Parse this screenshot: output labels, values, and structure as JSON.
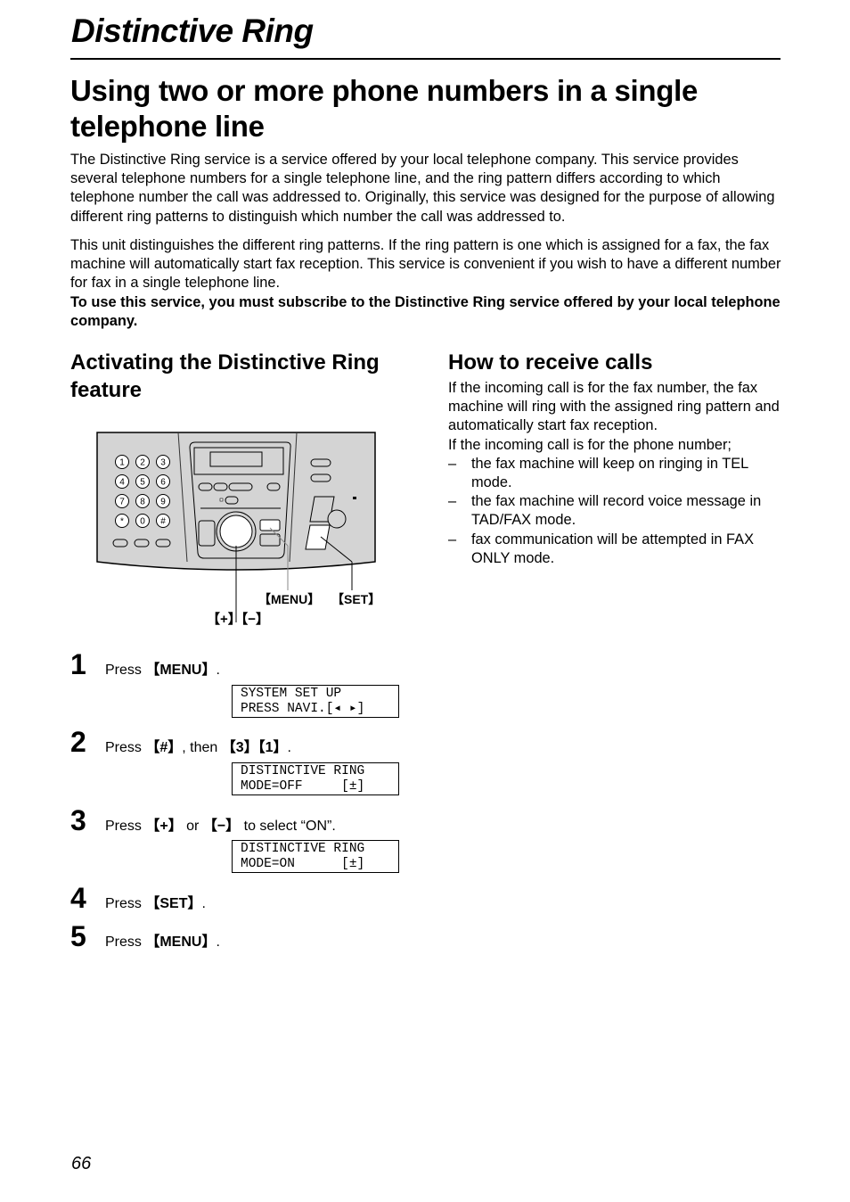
{
  "header": {
    "page_title": "Distinctive Ring"
  },
  "main": {
    "heading": "Using two or more phone numbers in a single telephone line",
    "paragraphs": [
      "The Distinctive Ring service is a service offered by your local telephone company. This service provides several telephone numbers for a single telephone line, and the ring pattern differs according to which telephone number the call was addressed to. Originally, this service was designed for the purpose of allowing different ring patterns to distinguish which number the call was addressed to.",
      "This unit distinguishes the different ring patterns. If the ring pattern is one which is assigned for a fax, the fax machine will automatically start fax reception. This service is convenient if you wish to have a different number for fax in a single telephone line."
    ],
    "notice": "To use this service, you must subscribe to the Distinctive Ring service offered by your local telephone company."
  },
  "activating": {
    "heading_line1": "Activating the Distinctive Ring",
    "heading_line2": "feature",
    "diagram": {
      "keypad": [
        "1",
        "2",
        "3",
        "4",
        "5",
        "6",
        "7",
        "8",
        "9",
        "*",
        "0",
        "#"
      ],
      "label_menu": "【MENU】",
      "label_set": "【SET】",
      "label_plus_minus": "【+】【−】"
    },
    "steps": [
      {
        "num": "1",
        "pre": "Press ",
        "key1": "【MENU】",
        "mid": "",
        "key2": "",
        "post": ".",
        "lcd": [
          "SYSTEM SET UP",
          "PRESS NAVI.[◂ ▸]"
        ]
      },
      {
        "num": "2",
        "pre": "Press ",
        "key1": "【#】",
        "mid": ", then ",
        "key2": "【3】【1】",
        "post": ".",
        "lcd": [
          "DISTINCTIVE RING",
          "MODE=OFF     [±]"
        ]
      },
      {
        "num": "3",
        "pre": "Press ",
        "key1": "【+】",
        "mid": " or ",
        "key2": "【−】",
        "post": " to select “ON”.",
        "lcd": [
          "DISTINCTIVE RING",
          "MODE=ON      [±]"
        ]
      },
      {
        "num": "4",
        "pre": "Press ",
        "key1": "【SET】",
        "mid": "",
        "key2": "",
        "post": "."
      },
      {
        "num": "5",
        "pre": "Press ",
        "key1": "【MENU】",
        "mid": "",
        "key2": "",
        "post": "."
      }
    ]
  },
  "receiving": {
    "heading": "How to receive calls",
    "intro": "If the incoming call is for the fax number, the fax machine will ring with the assigned ring pattern and automatically start fax reception.",
    "phone_intro": "If the incoming call is for the phone number;",
    "bullets": [
      "the fax machine will keep on ringing in TEL mode.",
      "the fax machine will record voice message in TAD/FAX mode.",
      "fax communication will be attempted in FAX ONLY mode."
    ],
    "dash": "–"
  },
  "footer": {
    "page_number": "66"
  }
}
